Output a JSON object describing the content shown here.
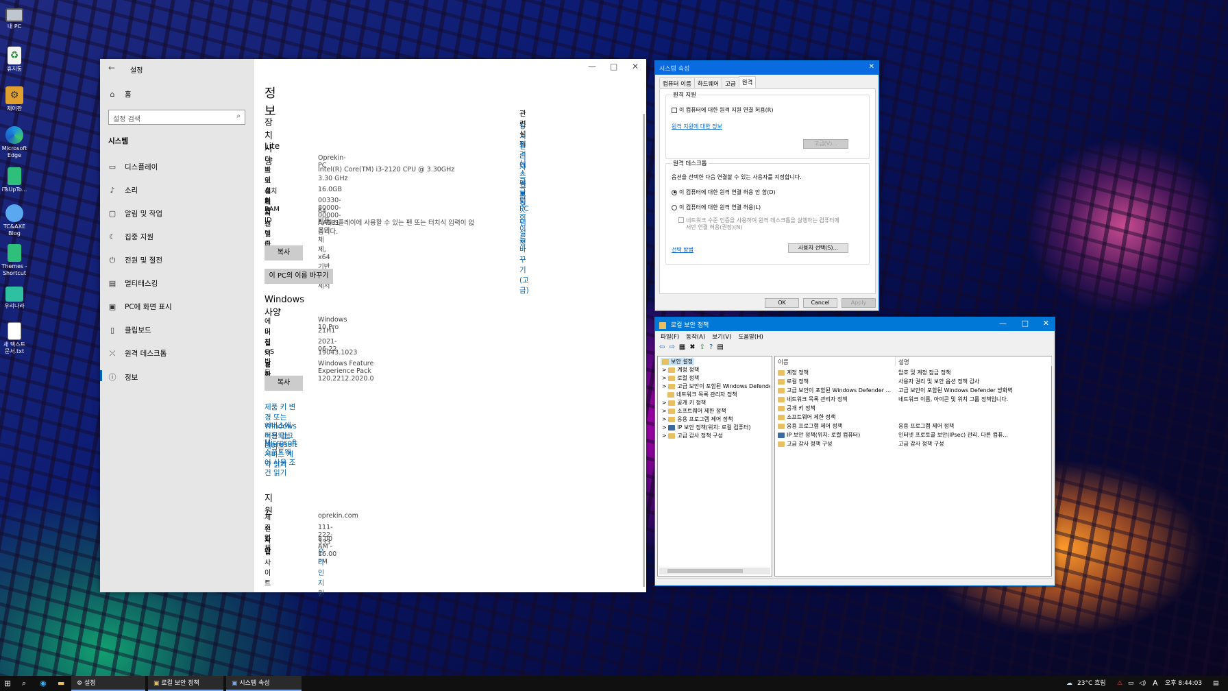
{
  "desktop": {
    "icons": [
      {
        "label": "내 PC",
        "icon": "computer-icon"
      },
      {
        "label": "휴지통",
        "icon": "recycle-bin-icon"
      },
      {
        "label": "제어판",
        "icon": "control-panel-icon"
      },
      {
        "label": "Microsoft Edge",
        "icon": "edge-icon"
      },
      {
        "label": "iTsUpTo...",
        "icon": "notebook-icon"
      },
      {
        "label": "TC&AXE Blog",
        "icon": "cloud-icon"
      },
      {
        "label": "Themes - Shortcut",
        "icon": "themes-icon"
      },
      {
        "label": "우리나라",
        "icon": "folder-icon"
      },
      {
        "label": "새 텍스트 문서.txt",
        "icon": "text-file-icon"
      }
    ]
  },
  "settings": {
    "title": "설정",
    "nav_home": "홈",
    "search_placeholder": "설정 검색",
    "section": "시스템",
    "nav_items": [
      {
        "label": "디스플레이",
        "icon": "display-icon"
      },
      {
        "label": "소리",
        "icon": "sound-icon"
      },
      {
        "label": "알림 및 작업",
        "icon": "notification-icon"
      },
      {
        "label": "집중 지원",
        "icon": "focus-icon"
      },
      {
        "label": "전원 및 절전",
        "icon": "power-icon"
      },
      {
        "label": "멀티태스킹",
        "icon": "multitask-icon"
      },
      {
        "label": "PC에 화면 표시",
        "icon": "project-icon"
      },
      {
        "label": "클립보드",
        "icon": "clipboard-icon"
      },
      {
        "label": "원격 데스크톱",
        "icon": "remote-icon"
      },
      {
        "label": "정보",
        "icon": "info-icon"
      }
    ],
    "page_title": "정보",
    "device_heading": "장치 사양",
    "device_name_big": "Lite",
    "device_specs": [
      {
        "label": "디바이스 이름",
        "value": "Oprekin-PC"
      },
      {
        "label": "프로세서",
        "value": "Intel(R) Core(TM) i3-2120 CPU @ 3.30GHz   3.30 GHz"
      },
      {
        "label": "설치된 RAM",
        "value": "16.0GB"
      },
      {
        "label": "제품 ID",
        "value": "00330-80000-00000-AA501"
      },
      {
        "label": "시스템 종류",
        "value": "64비트 운영 체제, x64 기반 프로세서"
      },
      {
        "label": "펜 및 터치",
        "value": "이 디스플레이에 사용할 수 있는 펜 또는 터치식 입력이 없습니다."
      }
    ],
    "copy_label": "복사",
    "rename_label": "이 PC의 이름 바꾸기",
    "windows_heading": "Windows 사양",
    "windows_specs": [
      {
        "label": "에디션",
        "value": "Windows 10 Pro"
      },
      {
        "label": "버전",
        "value": "21H1"
      },
      {
        "label": "설치 날짜",
        "value": "2021-06-22"
      },
      {
        "label": "OS 빌드",
        "value": "19043.1023"
      },
      {
        "label": "경험",
        "value": "Windows Feature Experience Pack 120.2212.2020.0"
      }
    ],
    "links": [
      "제품 키 변경 또는 Windows 버전 업그레이드",
      "서비스에 적용되는 Microsoft 서비스 계약 읽기",
      "Microsoft 소프트웨어 사용 조건 읽기"
    ],
    "support_heading": "지원",
    "support": [
      {
        "label": "제조업체",
        "value": "oprekin.com"
      },
      {
        "label": "전화",
        "value": "111-222-333"
      },
      {
        "label": "시간",
        "value": "8.00 AM - 16.00 PM"
      },
      {
        "label": "웹 사이트",
        "value": "온라인 지원"
      }
    ],
    "related_heading": "관련 설정",
    "related": [
      "장치 관리자",
      "원격 데스크톱",
      "시스템 보호",
      "고급 시스템 설정",
      "이 PC의 이름 바꾸기(고급)"
    ]
  },
  "sysprop": {
    "title": "시스템 속성",
    "tabs": [
      "컴퓨터 이름",
      "하드웨어",
      "고급",
      "원격"
    ],
    "assist_group": "원격 지원",
    "assist_checkbox": "이 컴퓨터에 대한 원격 지원 연결 허용(R)",
    "assist_link": "원격 지원에 대한 정보",
    "advanced_btn": "고급(V)...",
    "rd_group": "원격 데스크톱",
    "rd_desc": "옵션을 선택한 다음 연결할 수 있는 사용자를 지정합니다.",
    "rd_opt1": "이 컴퓨터에 대한 원격 연결 허용 안 함(D)",
    "rd_opt2": "이 컴퓨터에 대한 원격 연결 허용(L)",
    "rd_nla": "네트워크 수준 인증을 사용하여 원격 데스크톱을 실행하는 컴퓨터에서만 연결 허용(권장)(N)",
    "choose_link": "선택 방법",
    "users_btn": "사용자 선택(S)...",
    "ok": "OK",
    "cancel": "Cancel",
    "apply": "Apply"
  },
  "secpol": {
    "title": "로컬 보안 정책",
    "menu": [
      "파일(F)",
      "동작(A)",
      "보기(V)",
      "도움말(H)"
    ],
    "tree_root": "보안 설정",
    "tree_items": [
      "계정 정책",
      "로컬 정책",
      "고급 보안이 포함된 Windows Defende",
      "네트워크 목록 관리자 정책",
      "공개 키 정책",
      "소프트웨어 제한 정책",
      "응용 프로그램 제어 정책",
      "IP 보안 정책(위치: 로컬 컴퓨터)",
      "고급 감사 정책 구성"
    ],
    "col_name": "이름",
    "col_desc": "설명",
    "rows": [
      {
        "name": "계정 정책",
        "desc": "암호 및 계정 잠금 정책"
      },
      {
        "name": "로컬 정책",
        "desc": "사용자 권리 및 보안 옵션 정책 감사"
      },
      {
        "name": "고급 보안이 포함된 Windows Defender ...",
        "desc": "고급 보안이 포함된 Windows Defender 방화벽"
      },
      {
        "name": "네트워크 목록 관리자 정책",
        "desc": "네트워크 이름, 아이콘 및 위치 그룹 정책입니다."
      },
      {
        "name": "공개 키 정책",
        "desc": ""
      },
      {
        "name": "소프트웨어 제한 정책",
        "desc": ""
      },
      {
        "name": "응용 프로그램 제어 정책",
        "desc": "응용 프로그램 제어 정책"
      },
      {
        "name": "IP 보안 정책(위치: 로컬 컴퓨터)",
        "desc": "인터넷 프로토콜 보안(IPsec) 관리. 다른 컴퓨..."
      },
      {
        "name": "고급 감사 정책 구성",
        "desc": "고급 감사 정책 구성"
      }
    ]
  },
  "taskbar": {
    "items": [
      "설정",
      "로컬 보안 정책",
      "시스템 속성"
    ],
    "weather": "23°C  흐림",
    "lang": "A",
    "clock": "오후 8:44:03"
  }
}
